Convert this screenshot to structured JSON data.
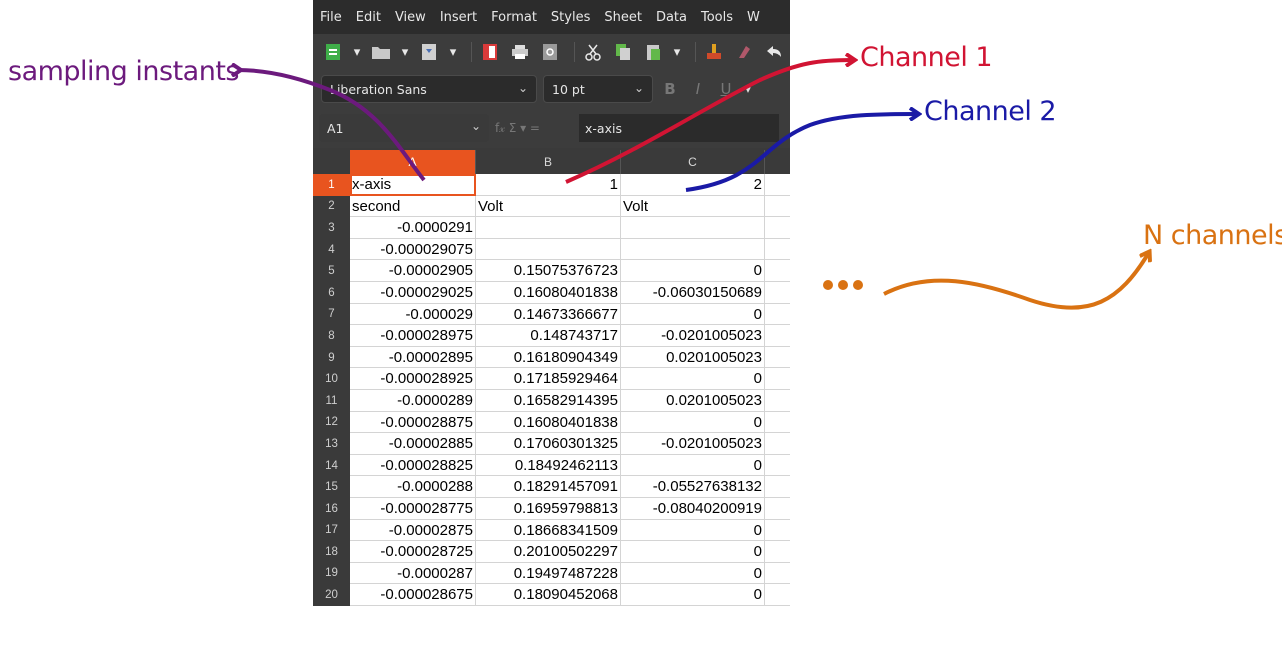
{
  "annotations": {
    "sampling_instants": {
      "text": "sampling instants",
      "color": "#6c1a7d"
    },
    "channel_1": {
      "text": "Channel 1",
      "color": "#d11433"
    },
    "channel_2": {
      "text": "Channel 2",
      "color": "#1a1aa6"
    },
    "n_channels": {
      "text": "N channels",
      "color": "#d97212"
    },
    "ellipsis_color": "#d97212"
  },
  "menubar": {
    "items": [
      "File",
      "Edit",
      "View",
      "Insert",
      "Format",
      "Styles",
      "Sheet",
      "Data",
      "Tools",
      "W"
    ]
  },
  "toolbar": {
    "icons": [
      "new-document-icon",
      "open-folder-icon",
      "save-icon",
      "export-pdf-icon",
      "print-icon",
      "print-preview-icon",
      "cut-icon",
      "copy-icon",
      "paste-icon",
      "clone-formatting-icon",
      "clear-formatting-icon",
      "undo-icon"
    ]
  },
  "fontbar": {
    "font_name": "Liberation Sans",
    "font_size": "10 pt",
    "bold": "B",
    "italic": "I",
    "underline": "U"
  },
  "formulabar": {
    "name_box": "A1",
    "fx_icons": "f𝓍  Σ  ▾  =",
    "content": "x-axis"
  },
  "sheet": {
    "columns": [
      "A",
      "B",
      "C"
    ],
    "selected_column": "A",
    "rows": [
      {
        "n": "1",
        "a": "x-axis",
        "b": "1",
        "c": "2"
      },
      {
        "n": "2",
        "a": "second",
        "b": "Volt",
        "c": "Volt"
      },
      {
        "n": "3",
        "a": "-0.0000291",
        "b": "",
        "c": ""
      },
      {
        "n": "4",
        "a": "-0.000029075",
        "b": "",
        "c": ""
      },
      {
        "n": "5",
        "a": "-0.00002905",
        "b": "0.15075376723",
        "c": "0"
      },
      {
        "n": "6",
        "a": "-0.000029025",
        "b": "0.16080401838",
        "c": "-0.06030150689"
      },
      {
        "n": "7",
        "a": "-0.000029",
        "b": "0.14673366677",
        "c": "0"
      },
      {
        "n": "8",
        "a": "-0.000028975",
        "b": "0.148743717",
        "c": "-0.0201005023"
      },
      {
        "n": "9",
        "a": "-0.00002895",
        "b": "0.16180904349",
        "c": "0.0201005023"
      },
      {
        "n": "10",
        "a": "-0.000028925",
        "b": "0.17185929464",
        "c": "0"
      },
      {
        "n": "11",
        "a": "-0.0000289",
        "b": "0.16582914395",
        "c": "0.0201005023"
      },
      {
        "n": "12",
        "a": "-0.000028875",
        "b": "0.16080401838",
        "c": "0"
      },
      {
        "n": "13",
        "a": "-0.00002885",
        "b": "0.17060301325",
        "c": "-0.0201005023"
      },
      {
        "n": "14",
        "a": "-0.000028825",
        "b": "0.18492462113",
        "c": "0"
      },
      {
        "n": "15",
        "a": "-0.0000288",
        "b": "0.18291457091",
        "c": "-0.05527638132"
      },
      {
        "n": "16",
        "a": "-0.000028775",
        "b": "0.16959798813",
        "c": "-0.08040200919"
      },
      {
        "n": "17",
        "a": "-0.00002875",
        "b": "0.18668341509",
        "c": "0"
      },
      {
        "n": "18",
        "a": "-0.000028725",
        "b": "0.20100502297",
        "c": "0"
      },
      {
        "n": "19",
        "a": "-0.0000287",
        "b": "0.19497487228",
        "c": "0"
      },
      {
        "n": "20",
        "a": "-0.000028675",
        "b": "0.18090452068",
        "c": "0"
      }
    ]
  }
}
